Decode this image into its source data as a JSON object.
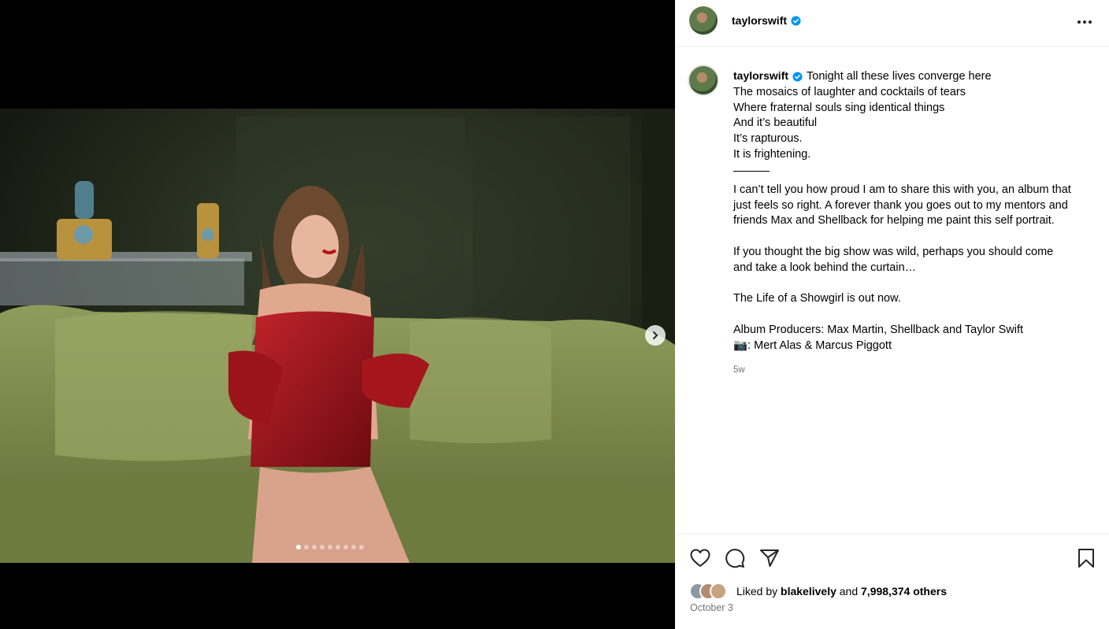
{
  "post": {
    "username": "taylorswift",
    "verified": true
  },
  "header": {
    "more_icon": "more-horizontal-icon"
  },
  "caption": {
    "first_line": "Tonight all these lives converge here",
    "lines": [
      "The mosaics of laughter and cocktails of tears",
      "Where fraternal souls sing identical things",
      "And it’s beautiful",
      "It’s rapturous.",
      "It is frightening."
    ],
    "paragraph1": [
      "I can’t tell you how proud I am to share this with you, an album that",
      "just feels so right. A forever thank you goes out to my mentors and",
      "friends Max and Shellback for helping me paint this self portrait."
    ],
    "paragraph2": [
      "If you thought the big show was wild, perhaps you should come",
      "and take a look behind the curtain…"
    ],
    "paragraph3": "The Life of a Showgirl is out now.",
    "producers": "Album Producers: Max Martin, Shellback and Taylor Swift",
    "photo_credit": "📷: Mert Alas & Marcus Piggott",
    "time_ago": "5w"
  },
  "media": {
    "slide_count": 9,
    "active_slide": 1,
    "next_icon": "chevron-right-icon"
  },
  "actions": {
    "like_icon": "heart-icon",
    "comment_icon": "comment-icon",
    "share_icon": "send-icon",
    "save_icon": "bookmark-icon"
  },
  "likes": {
    "prefix": "Liked by",
    "liker": "blakelively",
    "conjunction": "and",
    "others": "7,998,374 others"
  },
  "date": "October 3",
  "colors": {
    "verified": "#0095f6",
    "secondary_text": "#737373",
    "border": "#efefef"
  }
}
